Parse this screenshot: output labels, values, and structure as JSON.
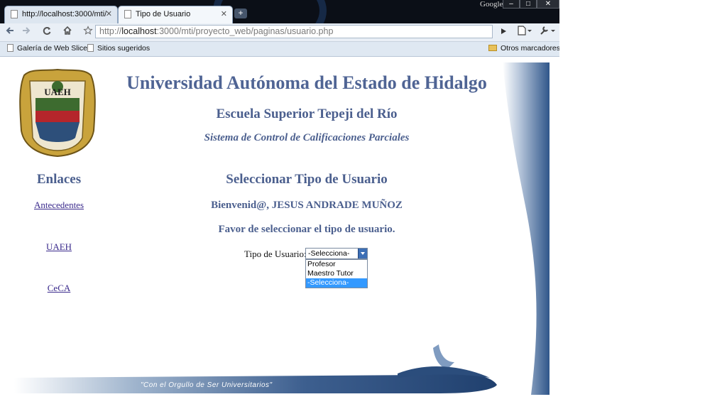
{
  "browser": {
    "tabs": [
      {
        "label": "http://localhost:3000/mti/",
        "active": false
      },
      {
        "label": "Tipo de Usuario",
        "active": true
      }
    ],
    "window_brand": "Google",
    "window_controls": {
      "minimize": "–",
      "maximize": "□",
      "close": "✕"
    },
    "url": {
      "prefix": "http://",
      "host": "localhost",
      "rest": ":3000/mti/proyecto_web/paginas/usuario.php"
    },
    "bookmarks": [
      "Galería de Web Slice",
      "Sitios sugeridos"
    ],
    "other_bookmarks": "Otros marcadores",
    "icons": {
      "back": "back-arrow-icon",
      "forward": "forward-arrow-icon",
      "reload": "reload-icon",
      "home": "home-icon",
      "star": "star-icon",
      "go": "play-icon",
      "page": "page-menu-icon",
      "wrench": "wrench-icon"
    }
  },
  "header": {
    "university": "Universidad Autónoma del Estado de Hidalgo",
    "school": "Escuela Superior Tepeji del Río",
    "system": "Sistema de Control de Calificaciones Parciales",
    "logo_text": "UAEH"
  },
  "sidebar": {
    "title": "Enlaces",
    "links": [
      "Antecedentes",
      "UAEH",
      "CeCA"
    ]
  },
  "main": {
    "title": "Seleccionar Tipo de Usuario",
    "welcome": "Bienvenid@, JESUS ANDRADE MUÑOZ",
    "instruction": "Favor de seleccionar el tipo de usuario.",
    "select_label": "Tipo de Usuario:",
    "select_value": "-Selecciona-",
    "options": [
      "Profesor",
      "Maestro Tutor",
      "-Selecciona-"
    ],
    "highlighted_option": "-Selecciona-"
  },
  "footer": {
    "motto": "\"Con el Orgullo de Ser Universitarios\""
  },
  "colors": {
    "heading": "#4b5f8e",
    "link": "#3a2a8c",
    "band": "#3d5f8f",
    "highlight": "#3399ff"
  }
}
